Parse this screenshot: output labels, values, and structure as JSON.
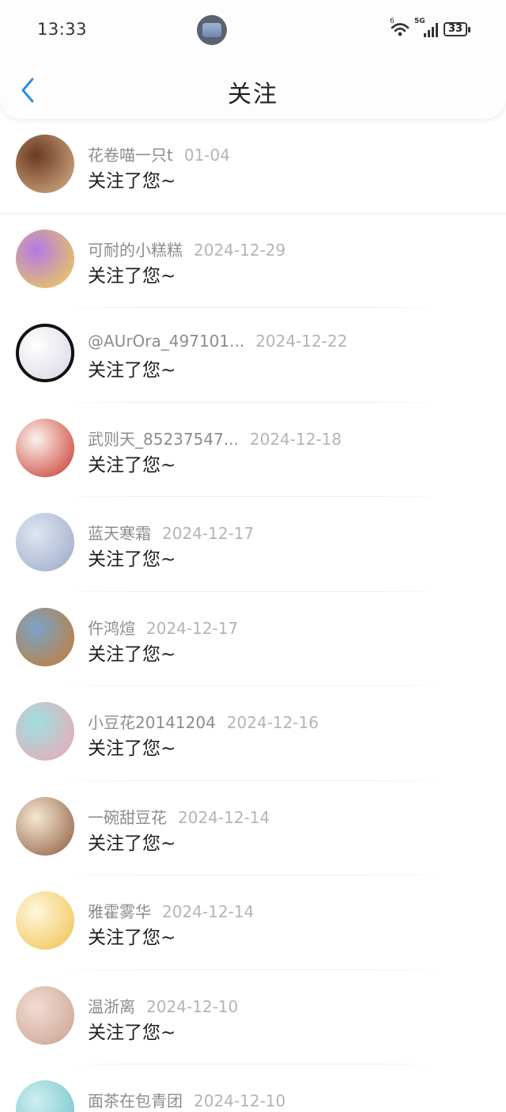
{
  "status": {
    "time": "13:33",
    "battery": "33",
    "signal_label": "5G",
    "wifi_label": "6"
  },
  "nav": {
    "title": "关注"
  },
  "follows": [
    {
      "name": "花卷喵一只t",
      "date": "01-04",
      "message": "关注了您~",
      "avatar_colors": [
        "#6b3a22",
        "#d9b48a"
      ]
    },
    {
      "name": "可耐的小糕糕",
      "date": "2024-12-29",
      "message": "关注了您~",
      "avatar_colors": [
        "#b27ae6",
        "#f3d24b"
      ]
    },
    {
      "name": "@AUrOra_497101...",
      "date": "2024-12-22",
      "message": "关注了您~",
      "avatar_colors": [
        "#ffffff",
        "#d6d6e2"
      ]
    },
    {
      "name": "武则天_85237547...",
      "date": "2024-12-18",
      "message": "关注了您~",
      "avatar_colors": [
        "#fbf4ec",
        "#c8322a"
      ]
    },
    {
      "name": "蓝天寒霜",
      "date": "2024-12-17",
      "message": "关注了您~",
      "avatar_colors": [
        "#dfe6f2",
        "#9aa7c6"
      ]
    },
    {
      "name": "仵鸿煊",
      "date": "2024-12-17",
      "message": "关注了您~",
      "avatar_colors": [
        "#7aa3c8",
        "#c77b2e"
      ]
    },
    {
      "name": "小豆花20141204",
      "date": "2024-12-16",
      "message": "关注了您~",
      "avatar_colors": [
        "#9fe0e0",
        "#f2a3b3"
      ]
    },
    {
      "name": "一碗甜豆花",
      "date": "2024-12-14",
      "message": "关注了您~",
      "avatar_colors": [
        "#f6e7d4",
        "#8a5a3a"
      ]
    },
    {
      "name": "雅霍雾华",
      "date": "2024-12-14",
      "message": "关注了您~",
      "avatar_colors": [
        "#fff6dd",
        "#f0c14b"
      ]
    },
    {
      "name": "温浙离",
      "date": "2024-12-10",
      "message": "关注了您~",
      "avatar_colors": [
        "#f1dcd2",
        "#c9a28f"
      ]
    },
    {
      "name": "面茶在包青团",
      "date": "2024-12-10",
      "message": "",
      "avatar_colors": [
        "#cfeef0",
        "#6cc1c8"
      ]
    }
  ]
}
